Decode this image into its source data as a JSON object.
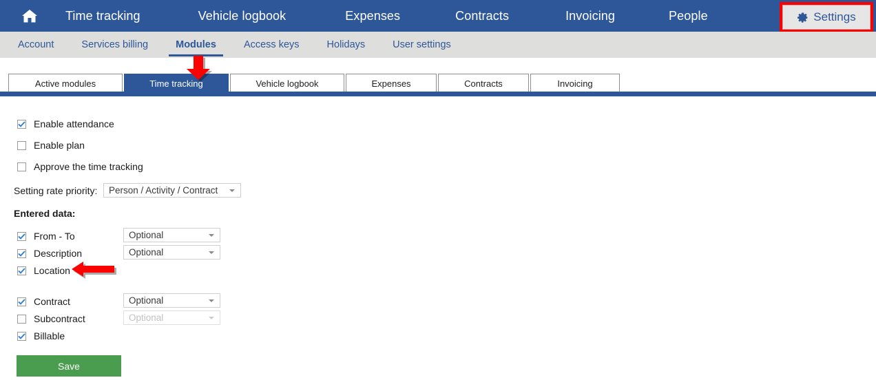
{
  "topnav": {
    "home_icon": "home-icon",
    "items": [
      {
        "label": "Time tracking"
      },
      {
        "label": "Vehicle logbook"
      },
      {
        "label": "Expenses"
      },
      {
        "label": "Contracts"
      },
      {
        "label": "Invoicing"
      },
      {
        "label": "People"
      }
    ],
    "settings": {
      "label": "Settings",
      "icon": "gear-icon",
      "highlight_color": "#ff0000"
    },
    "bg_color": "#2E5799"
  },
  "subnav": {
    "items": [
      {
        "label": "Account",
        "active": false
      },
      {
        "label": "Services billing",
        "active": false
      },
      {
        "label": "Modules",
        "active": true
      },
      {
        "label": "Access keys",
        "active": false
      },
      {
        "label": "Holidays",
        "active": false
      },
      {
        "label": "User settings",
        "active": false
      }
    ]
  },
  "module_tabs": {
    "items": [
      {
        "label": "Active modules",
        "active": false
      },
      {
        "label": "Time tracking",
        "active": true
      },
      {
        "label": "Vehicle logbook",
        "active": false
      },
      {
        "label": "Expenses",
        "active": false
      },
      {
        "label": "Contracts",
        "active": false
      },
      {
        "label": "Invoicing",
        "active": false
      }
    ]
  },
  "settings_form": {
    "toggles": [
      {
        "label": "Enable attendance",
        "checked": true
      },
      {
        "label": "Enable plan",
        "checked": false
      },
      {
        "label": "Approve the time tracking",
        "checked": false
      }
    ],
    "rate_priority": {
      "label": "Setting rate priority:",
      "value": "Person / Activity / Contract"
    },
    "entered_data": {
      "heading": "Entered data:",
      "rows": [
        {
          "label": "From - To",
          "checked": true,
          "dropdown": "Optional",
          "dropdown_enabled": true
        },
        {
          "label": "Description",
          "checked": true,
          "dropdown": "Optional",
          "dropdown_enabled": true
        },
        {
          "label": "Location",
          "checked": true,
          "dropdown": null,
          "dropdown_enabled": false
        },
        {
          "label": "Contract",
          "checked": true,
          "dropdown": "Optional",
          "dropdown_enabled": true
        },
        {
          "label": "Subcontract",
          "checked": false,
          "dropdown": "Optional",
          "dropdown_enabled": false
        },
        {
          "label": "Billable",
          "checked": true,
          "dropdown": null,
          "dropdown_enabled": false
        }
      ]
    },
    "save_label": "Save",
    "save_color": "#4a9d4f"
  },
  "annotations": {
    "arrow_down_target": "Time tracking tab",
    "arrow_left_target": "Location checkbox",
    "arrow_color": "#ff0000"
  }
}
